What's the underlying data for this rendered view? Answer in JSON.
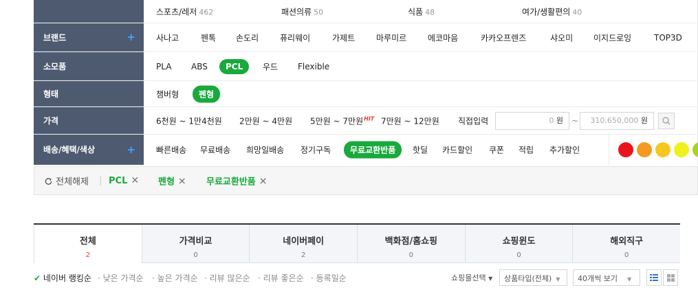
{
  "categories": [
    {
      "label": "스포츠/레저",
      "count": "462"
    },
    {
      "label": "패션의류",
      "count": "50"
    },
    {
      "label": "식품",
      "count": "48"
    },
    {
      "label": "여가/생활편의",
      "count": "40"
    }
  ],
  "brand": {
    "label": "브랜드",
    "items": [
      "사나고",
      "펜톡",
      "손도리",
      "퓨리웨이",
      "가제트",
      "마루미르",
      "에코마음",
      "카카오프렌즈",
      "샤오미",
      "이지드로잉",
      "TOP3D"
    ]
  },
  "consumable": {
    "label": "소모품",
    "items": [
      "PLA",
      "ABS",
      "PCL",
      "우드",
      "Flexible"
    ],
    "selected": "PCL"
  },
  "form": {
    "label": "형태",
    "items": [
      "챔버형",
      "펜형"
    ],
    "selected": "펜형"
  },
  "price": {
    "label": "가격",
    "ranges": [
      "6천원 ~ 1만4천원",
      "2만원 ~ 4만원",
      "5만원 ~ 7만원",
      "7만원 ~ 12만원"
    ],
    "hit_badge": "HIT",
    "custom_label": "직접입력",
    "min_value": "0",
    "max_value": "310,650,000",
    "unit": "원",
    "separator": "~"
  },
  "delivery": {
    "label": "배송/혜택/색상",
    "items": [
      "빠른배송",
      "무료배송",
      "희망일배송",
      "정기구독",
      "무료교환반품",
      "핫딜",
      "카드할인",
      "쿠폰",
      "적립",
      "추가할인"
    ],
    "selected": "무료교환반품",
    "colors": [
      "#e8161c",
      "#f39a22",
      "#f6c81f",
      "#eef11d",
      "#a6d32a"
    ]
  },
  "selected_filters": {
    "reset_label": "전체해제",
    "items": [
      "PCL",
      "펜형",
      "무료교환반품"
    ]
  },
  "tabs": [
    {
      "name": "전체",
      "count": "2"
    },
    {
      "name": "가격비교",
      "count": "0"
    },
    {
      "name": "네이버페이",
      "count": "2"
    },
    {
      "name": "백화점/홈쇼핑",
      "count": "0"
    },
    {
      "name": "쇼핑윈도",
      "count": "0"
    },
    {
      "name": "해외직구",
      "count": "0"
    }
  ],
  "sort": {
    "options": [
      "네이버 랭킹순",
      "낮은 가격순",
      "높은 가격순",
      "리뷰 많은순",
      "리뷰 좋은순",
      "등록일순"
    ],
    "mall_select": "쇼핑몰선택",
    "product_type": "상품타입(전체)",
    "per_page": "40개씩 보기"
  }
}
